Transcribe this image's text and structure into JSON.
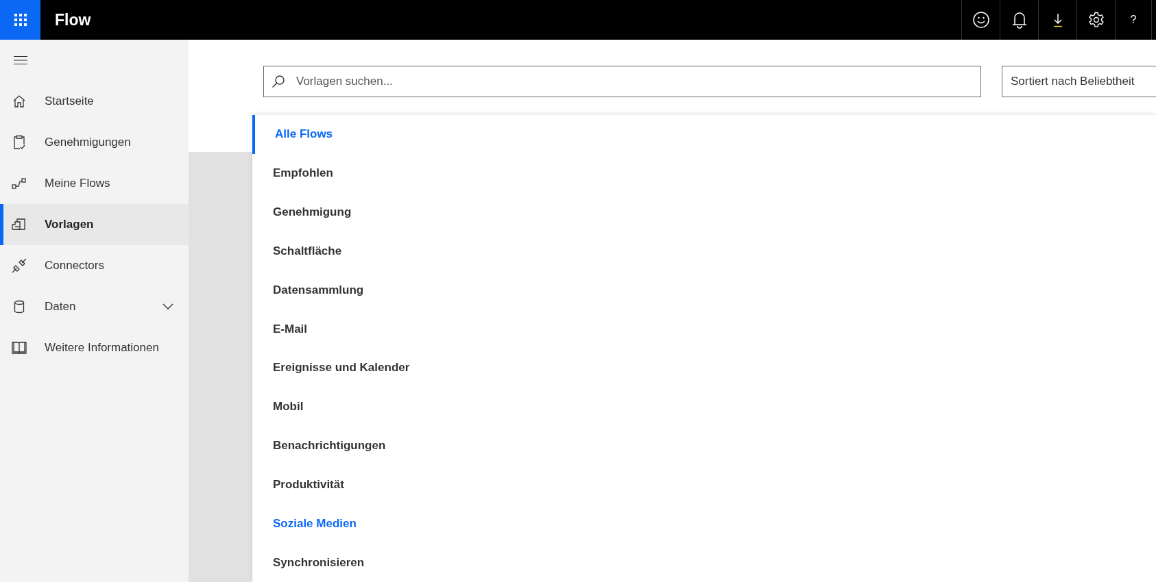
{
  "header": {
    "app_title": "Flow",
    "help": "?"
  },
  "sidebar": {
    "items": [
      {
        "label": "Startseite",
        "selected": false
      },
      {
        "label": "Genehmigungen",
        "selected": false
      },
      {
        "label": "Meine Flows",
        "selected": false
      },
      {
        "label": "Vorlagen",
        "selected": true
      },
      {
        "label": "Connectors",
        "selected": false
      },
      {
        "label": "Daten",
        "selected": false,
        "expanded": false
      },
      {
        "label": "Weitere Informationen",
        "selected": false
      }
    ]
  },
  "search": {
    "placeholder": "Vorlagen suchen..."
  },
  "sort": {
    "value": "Sortiert nach Beliebtheit"
  },
  "categories": [
    {
      "label": "Alle Flows",
      "selected": true,
      "hovered": false
    },
    {
      "label": "Empfohlen",
      "selected": false,
      "hovered": false
    },
    {
      "label": "Genehmigung",
      "selected": false,
      "hovered": false
    },
    {
      "label": "Schaltfläche",
      "selected": false,
      "hovered": false
    },
    {
      "label": "Datensammlung",
      "selected": false,
      "hovered": false
    },
    {
      "label": "E-Mail",
      "selected": false,
      "hovered": false
    },
    {
      "label": "Ereignisse und Kalender",
      "selected": false,
      "hovered": false
    },
    {
      "label": "Mobil",
      "selected": false,
      "hovered": false
    },
    {
      "label": "Benachrichtigungen",
      "selected": false,
      "hovered": false
    },
    {
      "label": "Produktivität",
      "selected": false,
      "hovered": false
    },
    {
      "label": "Soziale Medien",
      "selected": false,
      "hovered": true
    },
    {
      "label": "Synchronisieren",
      "selected": false,
      "hovered": false
    }
  ]
}
